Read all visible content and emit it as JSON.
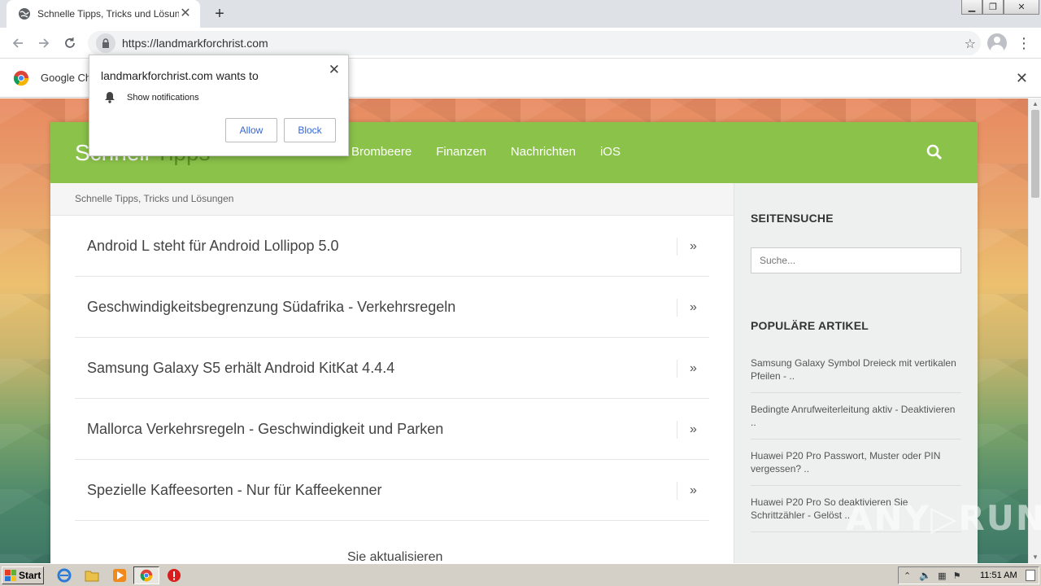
{
  "browser": {
    "tab_title": "Schnelle Tipps, Tricks und Lösungen",
    "url": "https://landmarkforchrist.com",
    "infobar_text": "Google Ch"
  },
  "permission_popup": {
    "title": "landmarkforchrist.com wants to",
    "permission": "Show notifications",
    "allow_label": "Allow",
    "block_label": "Block"
  },
  "site": {
    "logo_main": "Schnell",
    "logo_accent": "Tipps",
    "nav": [
      "Brombeere",
      "Finanzen",
      "Nachrichten",
      "iOS"
    ],
    "breadcrumb": "Schnelle Tipps, Tricks und Lösungen",
    "articles": [
      "Android L steht für Android Lollipop 5.0",
      "Geschwindigkeitsbegrenzung Südafrika - Verkehrsregeln",
      "Samsung Galaxy S5 erhält Android KitKat 4.4.4",
      "Mallorca Verkehrsregeln - Geschwindigkeit und Parken",
      "Spezielle Kaffeesorten - Nur für Kaffeekenner"
    ],
    "list_tail": "Sie aktualisieren",
    "sidebar": {
      "search_heading": "SEITENSUCHE",
      "search_placeholder": "Suche...",
      "popular_heading": "POPULÄRE ARTIKEL",
      "popular": [
        "Samsung Galaxy Symbol Dreieck mit vertikalen Pfeilen - ..",
        "Bedingte Anrufweiterleitung aktiv - Deaktivieren ..",
        "Huawei P20 Pro Passwort, Muster oder PIN vergessen? ..",
        "Huawei P20 Pro So deaktivieren Sie Schrittzähler - Gelöst .."
      ]
    }
  },
  "watermark": "ANY.RUN",
  "taskbar": {
    "start_label": "Start",
    "clock": "11:51 AM"
  },
  "colors": {
    "site_green": "#8bc34a",
    "link_blue": "#3367d6"
  }
}
